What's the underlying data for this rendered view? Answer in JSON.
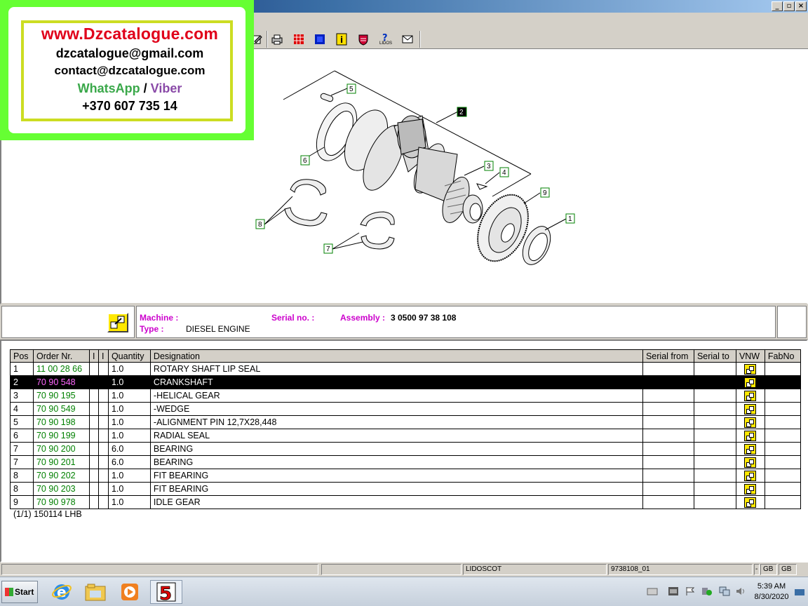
{
  "window": {
    "controls": [
      "_",
      "▫",
      "×"
    ]
  },
  "watermark": {
    "site": "www.Dzcatalogue.com",
    "email1": "dzcatalogue@gmail.com",
    "email2": "contact@dzcatalogue.com",
    "whatsapp": "WhatsApp",
    "slash": "/",
    "viber": "Viber",
    "phone": "+370 607 735 14"
  },
  "toolbar": {
    "icons": [
      "edit-icon",
      "print-icon",
      "grid-icon",
      "blue-grid-icon",
      "info-icon",
      "badge-icon",
      "help-icon",
      "mail-icon"
    ],
    "lidos_label": "LIDOS"
  },
  "diagram": {
    "callouts": [
      "5",
      "2",
      "6",
      "3",
      "4",
      "9",
      "8",
      "1",
      "7"
    ]
  },
  "info": {
    "machine_label": "Machine :",
    "machine_value": "",
    "serial_label": "Serial no. :",
    "serial_value": "",
    "assembly_label": "Assembly :",
    "assembly_value": "3 0500 97 38 108",
    "type_label": "Type :",
    "type_value": "DIESEL ENGINE"
  },
  "table": {
    "headers": [
      "Pos",
      "Order Nr.",
      "I",
      "I",
      "Quantity",
      "Designation",
      "Serial from",
      "Serial to",
      "VNW",
      "FabNo"
    ],
    "rows": [
      {
        "pos": "1",
        "order": "11 00 28 66",
        "qty": "1.0",
        "designation": "ROTARY SHAFT LIP SEAL"
      },
      {
        "pos": "2",
        "order": "70 90 548",
        "qty": "1.0",
        "designation": "CRANKSHAFT"
      },
      {
        "pos": "3",
        "order": "70 90 195",
        "qty": "1.0",
        "designation": "-HELICAL GEAR"
      },
      {
        "pos": "4",
        "order": "70 90 549",
        "qty": "1.0",
        "designation": "-WEDGE"
      },
      {
        "pos": "5",
        "order": "70 90 198",
        "qty": "1.0",
        "designation": "-ALIGNMENT PIN 12,7X28,448"
      },
      {
        "pos": "6",
        "order": "70 90 199",
        "qty": "1.0",
        "designation": "RADIAL SEAL"
      },
      {
        "pos": "7",
        "order": "70 90 200",
        "qty": "6.0",
        "designation": "BEARING"
      },
      {
        "pos": "7",
        "order": "70 90 201",
        "qty": "6.0",
        "designation": "BEARING"
      },
      {
        "pos": "8",
        "order": "70 90 202",
        "qty": "1.0",
        "designation": "FIT BEARING"
      },
      {
        "pos": "8",
        "order": "70 90 203",
        "qty": "1.0",
        "designation": "FIT BEARING"
      },
      {
        "pos": "9",
        "order": "70 90 978",
        "qty": "1.0",
        "designation": "IDLE GEAR"
      }
    ],
    "selected_index": 1,
    "footer": "(1/1) 150114 LHB"
  },
  "statusbar": {
    "app": "LIDOSCOT",
    "doc": "9738108_01",
    "dash": "-",
    "lang1": "GB",
    "lang2": "GB"
  },
  "taskbar": {
    "start": "Start",
    "time": "5:39 AM",
    "date": "8/30/2020"
  }
}
